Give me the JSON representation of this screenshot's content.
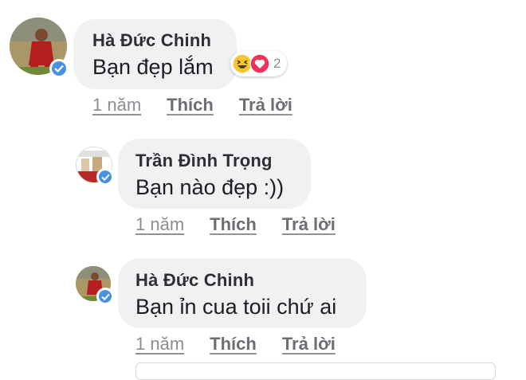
{
  "comments": [
    {
      "author": "Hà Đức Chinh",
      "text": "Bạn đẹp lắm",
      "time": "1 năm",
      "like": "Thích",
      "reply": "Trả lời",
      "reaction_count": "2",
      "reaction_icons": [
        "haha-icon",
        "love-icon"
      ]
    },
    {
      "author": "Trần Đình Trọng",
      "text": "Bạn nào đẹp :))",
      "time": "1 năm",
      "like": "Thích",
      "reply": "Trả lời"
    },
    {
      "author": "Hà Đức Chinh",
      "text": "Bạn ỉn cua toii chứ ai",
      "time": "1 năm",
      "like": "Thích",
      "reply": "Trả lời"
    }
  ],
  "colors": {
    "bubble": "#f0f1f3",
    "verified": "#4a90e2",
    "haha": "#f7c531",
    "love": "#f0325a"
  }
}
